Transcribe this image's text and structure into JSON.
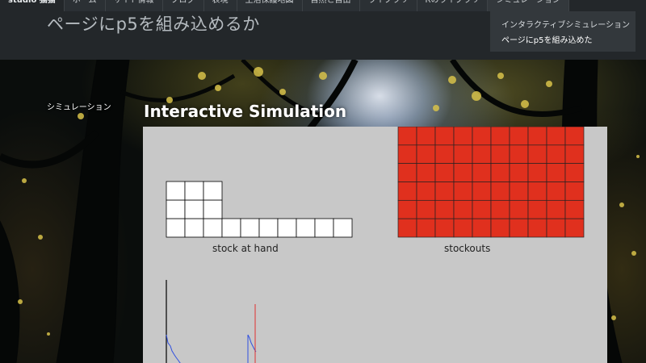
{
  "header": {
    "nav": [
      {
        "label": "studio 猫猫",
        "type": "brand"
      },
      {
        "label": "ホーム"
      },
      {
        "label": "サイト情報"
      },
      {
        "label": "ブログ"
      },
      {
        "label": "表現"
      },
      {
        "label": "生活保護地図"
      },
      {
        "label": "自然と自由"
      },
      {
        "label": "ライブラリ"
      },
      {
        "label": "Rのライブラリ"
      },
      {
        "label": "シミュレーション",
        "type": "active"
      }
    ],
    "page_title": "ページにp5を組み込めるか",
    "dropdown": [
      {
        "label": "インタラクティブシミュレーション"
      },
      {
        "label": "ページにp5を組み込めた",
        "current": true
      }
    ]
  },
  "sidebar": {
    "label": "シミュレーション"
  },
  "main": {
    "title": "Interactive Simulation"
  },
  "simulation": {
    "stock_caption": "stock at hand",
    "stockouts_caption": "stockouts",
    "stock_levels": [
      3,
      3,
      3,
      1,
      1,
      1,
      1,
      1,
      1,
      1
    ],
    "stockout_grid": {
      "cols": 10,
      "rows": 6
    },
    "colors": {
      "canvas_bg": "#c8c8c8",
      "stock_cell": "#ffffff",
      "stockout_cell": "#e0301e",
      "plot_line": "#3050e0",
      "plot_marker": "#e03030"
    }
  }
}
